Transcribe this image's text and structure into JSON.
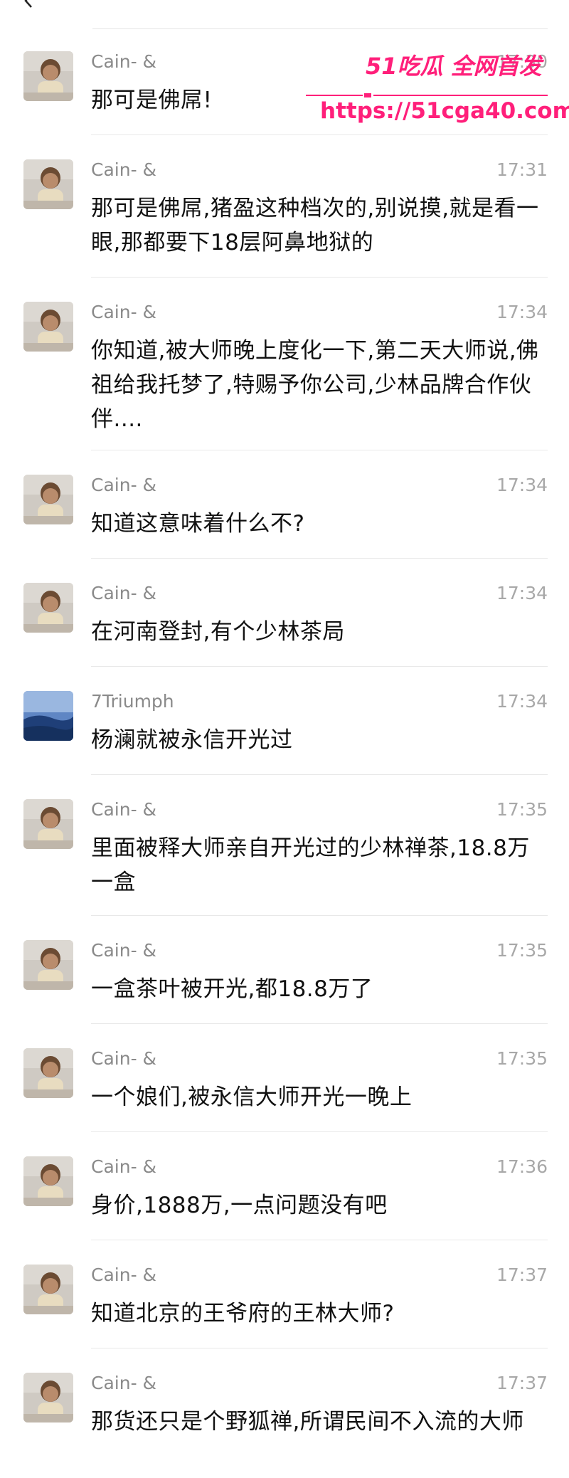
{
  "watermark": {
    "line1": "51吃瓜 全网首发",
    "line2": "https://51cga40.com",
    "color": "#ff1f7a"
  },
  "messages": [
    {
      "sender": "Cain- &",
      "time": "17:30",
      "text": "那可是佛屌!",
      "avatar": "baby-photo"
    },
    {
      "sender": "Cain- &",
      "time": "17:31",
      "text": "那可是佛屌,猪盈这种档次的,别说摸,就是看一眼,那都要下18层阿鼻地狱的",
      "avatar": "baby-photo"
    },
    {
      "sender": "Cain- &",
      "time": "17:34",
      "text": "你知道,被大师晚上度化一下,第二天大师说,佛祖给我托梦了,特赐予你公司,少林品牌合作伙伴....",
      "avatar": "baby-photo"
    },
    {
      "sender": "Cain- &",
      "time": "17:34",
      "text": "知道这意味着什么不?",
      "avatar": "baby-photo"
    },
    {
      "sender": "Cain- &",
      "time": "17:34",
      "text": "在河南登封,有个少林茶局",
      "avatar": "baby-photo"
    },
    {
      "sender": "7Triumph",
      "time": "17:34",
      "text": "杨澜就被永信开光过",
      "avatar": "sea-photo"
    },
    {
      "sender": "Cain- &",
      "time": "17:35",
      "text": "里面被释大师亲自开光过的少林禅茶,18.8万一盒",
      "avatar": "baby-photo"
    },
    {
      "sender": "Cain- &",
      "time": "17:35",
      "text": "一盒茶叶被开光,都18.8万了",
      "avatar": "baby-photo"
    },
    {
      "sender": "Cain- &",
      "time": "17:35",
      "text": "一个娘们,被永信大师开光一晚上",
      "avatar": "baby-photo"
    },
    {
      "sender": "Cain- &",
      "time": "17:36",
      "text": "身价,1888万,一点问题没有吧",
      "avatar": "baby-photo"
    },
    {
      "sender": "Cain- &",
      "time": "17:37",
      "text": "知道北京的王爷府的王林大师?",
      "avatar": "baby-photo"
    },
    {
      "sender": "Cain- &",
      "time": "17:37",
      "text": "那货还只是个野狐禅,所谓民间不入流的大师",
      "avatar": "baby-photo"
    }
  ]
}
